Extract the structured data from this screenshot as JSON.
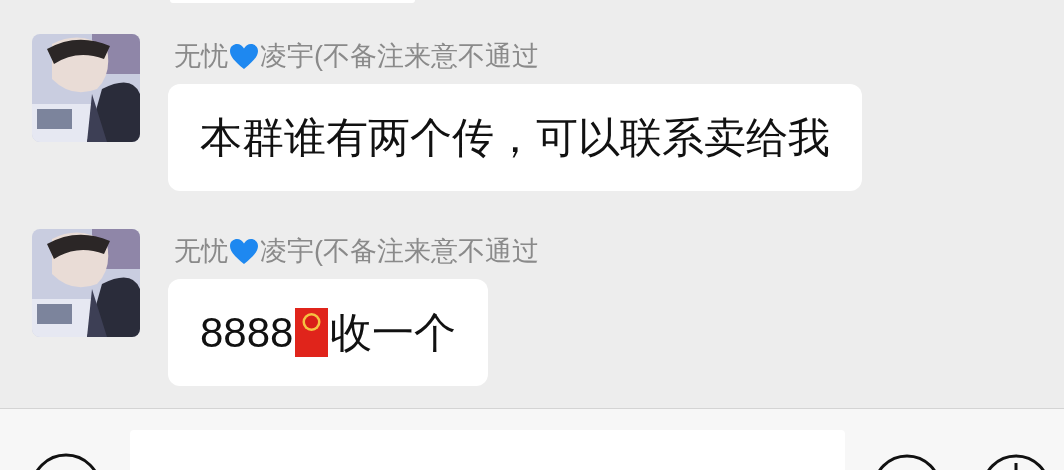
{
  "messages": [
    {
      "name": [
        {
          "kind": "text",
          "text": "无忧"
        },
        {
          "kind": "heart",
          "color": "#1e88f0"
        },
        {
          "kind": "text",
          "text": "凌宇(不备注来意不通过"
        }
      ],
      "content": [
        {
          "kind": "text",
          "text": "本群谁有两个传，可以联系卖给我"
        }
      ]
    },
    {
      "name": [
        {
          "kind": "text",
          "text": "无忧"
        },
        {
          "kind": "heart",
          "color": "#1e88f0"
        },
        {
          "kind": "text",
          "text": "凌宇(不备注来意不通过"
        }
      ],
      "content": [
        {
          "kind": "text",
          "text": "8888"
        },
        {
          "kind": "red-packet"
        },
        {
          "kind": "text",
          "text": "收一个"
        }
      ]
    }
  ]
}
